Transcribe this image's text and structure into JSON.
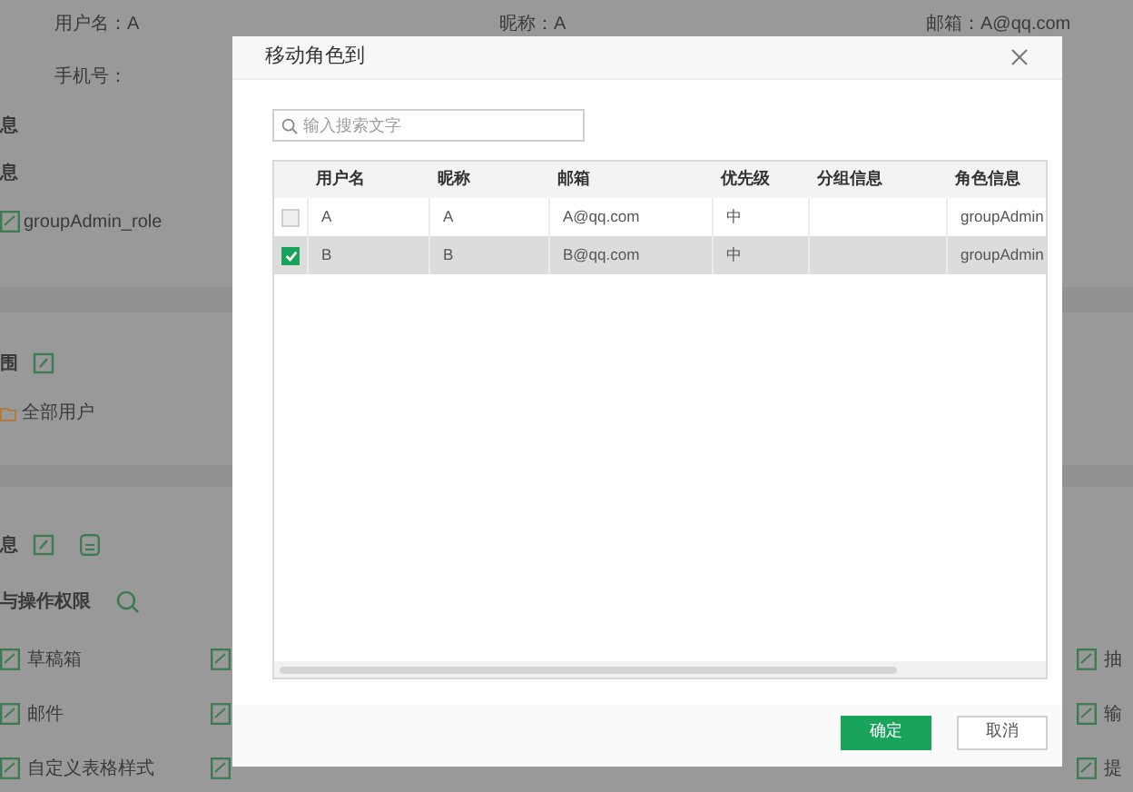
{
  "background": {
    "profile_row": [
      "用户名：A",
      "昵称：A",
      "邮箱：A@qq.com"
    ],
    "phone": "手机号：",
    "section_1": "息",
    "section_2": "息",
    "role_item": "groupAdmin_role",
    "scope_heading": "围",
    "scope_item": "全部用户",
    "info_heading": "息",
    "permission_heading": "与操作权限",
    "permissions": [
      {
        "left": "草稿箱",
        "right": "抽"
      },
      {
        "left": "邮件",
        "right": "输"
      },
      {
        "left": "自定义表格样式",
        "right": "提"
      }
    ]
  },
  "dialog": {
    "title": "移动角色到",
    "search": {
      "placeholder": "输入搜索文字"
    },
    "table": {
      "columns": [
        "用户名",
        "昵称",
        "邮箱",
        "优先级",
        "分组信息",
        "角色信息"
      ],
      "rows": [
        {
          "checked": false,
          "cells": [
            "A",
            "A",
            "A@qq.com",
            "中",
            "",
            "groupAdmin"
          ]
        },
        {
          "checked": true,
          "cells": [
            "B",
            "B",
            "B@qq.com",
            "中",
            "",
            "groupAdmin"
          ]
        }
      ]
    },
    "buttons": [
      {
        "label": "确定",
        "kind": "primary"
      },
      {
        "label": "取消",
        "kind": "secondary"
      }
    ]
  }
}
